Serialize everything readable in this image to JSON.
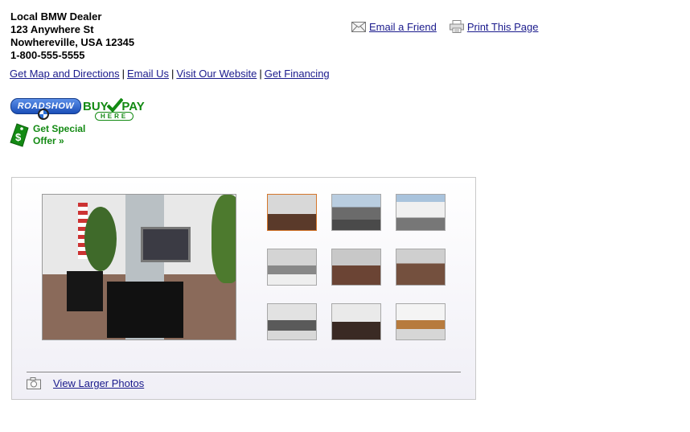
{
  "dealer": {
    "name": "Local BMW Dealer",
    "street": "123 Anywhere St",
    "city_state_zip": "Nowhereville, USA 12345",
    "phone": "1-800-555-5555"
  },
  "actions": {
    "email_friend": "Email a Friend",
    "print_page": "Print This Page",
    "email_icon": "envelope-icon",
    "print_icon": "printer-icon"
  },
  "links": {
    "map": "Get Map and Directions",
    "email": "Email Us",
    "website": "Visit Our Website",
    "financing": "Get Financing",
    "separator": "|"
  },
  "logos": {
    "roadshow": "ROADSHOW",
    "buy": "BUY",
    "pay": "PAY",
    "here": "HERE"
  },
  "offer": {
    "line1": "Get Special",
    "line2": "Offer »"
  },
  "gallery": {
    "view_larger": "View Larger Photos",
    "camera_icon": "camera-icon",
    "selected_index": 0
  },
  "colors": {
    "link": "#1a1a8c",
    "green": "#138a13",
    "selected_border": "#d4762b"
  }
}
